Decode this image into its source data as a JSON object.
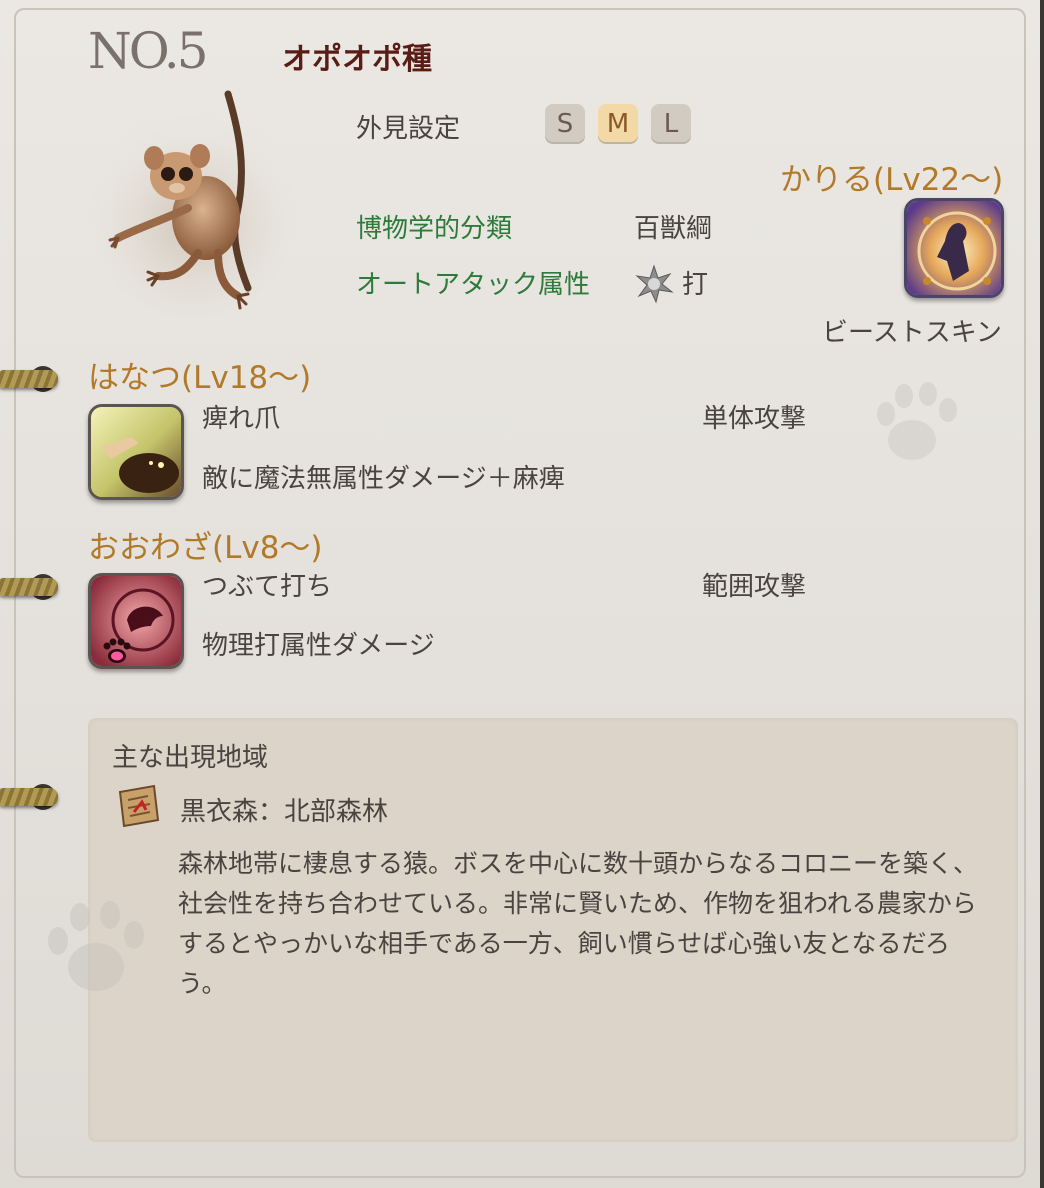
{
  "header": {
    "number": "NO.5",
    "species_name": "オポオポ種"
  },
  "appearance": {
    "label": "外見設定",
    "sizes": [
      "S",
      "M",
      "L"
    ],
    "selected": "M"
  },
  "classification": {
    "label": "博物学的分類",
    "value": "百獣綱"
  },
  "auto_attack": {
    "label": "オートアタック属性",
    "value": "打"
  },
  "borrow": {
    "title": "かりる(Lv22～)",
    "skill_name": "ビーストスキン"
  },
  "special": {
    "title": "はなつ(Lv18～)",
    "skill_name": "痺れ爪",
    "target": "単体攻撃",
    "description": "敵に魔法無属性ダメージ＋麻痺"
  },
  "big_move": {
    "title": "おおわざ(Lv8～)",
    "skill_name": "つぶて打ち",
    "target": "範囲攻撃",
    "description": "物理打属性ダメージ"
  },
  "region": {
    "title": "主な出現地域",
    "location": "黒衣森：北部森林",
    "description": "森林地帯に棲息する猿。ボスを中心に数十頭からなるコロニーを築く、社会性を持ち合わせている。非常に賢いため、作物を狙われる農家からするとやっかいな相手である一方、飼い慣らせば心強い友となるだろう。"
  },
  "colors": {
    "section_title": "#b07a2a",
    "green_label": "#2e7a3a",
    "species": "#5a1d16",
    "page": "#e8e5e0"
  }
}
